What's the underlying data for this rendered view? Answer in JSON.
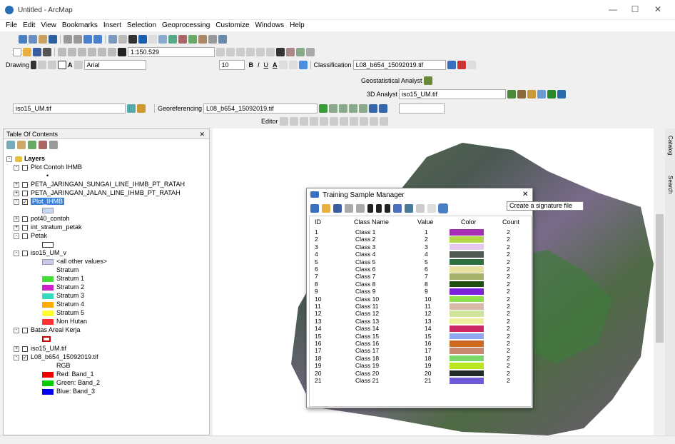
{
  "title": "Untitled - ArcMap",
  "menu": [
    "File",
    "Edit",
    "View",
    "Bookmarks",
    "Insert",
    "Selection",
    "Geoprocessing",
    "Customize",
    "Windows",
    "Help"
  ],
  "scale": "1:150.529",
  "drawing_label": "Drawing",
  "font_name": "Arial",
  "font_size": "10",
  "font_style": [
    "B",
    "I",
    "U"
  ],
  "classification_label": "Classification",
  "classification_layer": "L08_b654_15092019.tif",
  "geostat_label": "Geostatistical Analyst",
  "analyst3d_label": "3D Analyst",
  "analyst3d_layer": "iso15_UM.tif",
  "left_layer_select": "iso15_UM.tif",
  "georef_label": "Georeferencing",
  "georef_layer": "L08_b654_15092019.tif",
  "editor_label": "Editor",
  "toc": {
    "title": "Table Of Contents",
    "close": "✕",
    "rows": [
      {
        "label": "Layers",
        "bold": true
      },
      {
        "label": "Plot Contoh IHMB"
      },
      {
        "label": "•"
      },
      {
        "label": "PETA_JARINGAN_SUNGAI_LINE_IHMB_PT_RATAH"
      },
      {
        "label": "PETA_JARINGAN_JALAN_LINE_IHMB_PT_RATAH"
      },
      {
        "label": "Plot_IHMB",
        "selected": true
      },
      {
        "label": ""
      },
      {
        "label": "pot40_contoh"
      },
      {
        "label": "int_stratum_petak"
      },
      {
        "label": "Petak"
      },
      {
        "label": ""
      },
      {
        "label": "iso15_UM_v"
      },
      {
        "label": "<all other values>"
      },
      {
        "label": "Stratum"
      },
      {
        "label": "Stratum 1",
        "color": "#44dd33"
      },
      {
        "label": "Stratum 2",
        "color": "#cc22cc"
      },
      {
        "label": "Stratum 3",
        "color": "#33ddbb"
      },
      {
        "label": "Stratum 4",
        "color": "#ffaa00"
      },
      {
        "label": "Stratum 5",
        "color": "#ffff33"
      },
      {
        "label": "Non Hutan",
        "color": "#ff3333"
      },
      {
        "label": "Batas Areal Kerja"
      },
      {
        "label": ""
      },
      {
        "label": "iso15_UM.tif"
      },
      {
        "label": "L08_b654_15092019.tif"
      },
      {
        "label": "RGB"
      },
      {
        "label": "Red:   Band_1",
        "color": "#ee0000"
      },
      {
        "label": "Green: Band_2",
        "color": "#00cc00"
      },
      {
        "label": "Blue:  Band_3",
        "color": "#0000ee"
      }
    ]
  },
  "dialog": {
    "title": "Training Sample Manager",
    "close": "✕",
    "headers": [
      "ID",
      "Class Name",
      "Value",
      "Color",
      "Count"
    ],
    "rows": [
      {
        "id": "1",
        "name": "Class 1",
        "value": "1",
        "color": "#a52fb5",
        "count": "2"
      },
      {
        "id": "2",
        "name": "Class 2",
        "value": "2",
        "color": "#b4d84a",
        "count": "2"
      },
      {
        "id": "3",
        "name": "Class 3",
        "value": "3",
        "color": "#e6c9ee",
        "count": "2"
      },
      {
        "id": "4",
        "name": "Class 4",
        "value": "4",
        "color": "#4e5a52",
        "count": "2"
      },
      {
        "id": "5",
        "name": "Class 5",
        "value": "5",
        "color": "#2d6f3f",
        "count": "2"
      },
      {
        "id": "6",
        "name": "Class 6",
        "value": "6",
        "color": "#e8e09e",
        "count": "2"
      },
      {
        "id": "7",
        "name": "Class 7",
        "value": "7",
        "color": "#a6b06a",
        "count": "2"
      },
      {
        "id": "8",
        "name": "Class 8",
        "value": "8",
        "color": "#1f4d12",
        "count": "2"
      },
      {
        "id": "9",
        "name": "Class 9",
        "value": "9",
        "color": "#7b22dd",
        "count": "2"
      },
      {
        "id": "10",
        "name": "Class 10",
        "value": "10",
        "color": "#8ee04c",
        "count": "2"
      },
      {
        "id": "11",
        "name": "Class 11",
        "value": "11",
        "color": "#d8b8a6",
        "count": "2"
      },
      {
        "id": "12",
        "name": "Class 12",
        "value": "12",
        "color": "#cfe39a",
        "count": "2"
      },
      {
        "id": "13",
        "name": "Class 13",
        "value": "13",
        "color": "#ecef9e",
        "count": "2"
      },
      {
        "id": "14",
        "name": "Class 14",
        "value": "14",
        "color": "#cc2a66",
        "count": "2"
      },
      {
        "id": "15",
        "name": "Class 15",
        "value": "15",
        "color": "#8fa8f0",
        "count": "2"
      },
      {
        "id": "16",
        "name": "Class 16",
        "value": "16",
        "color": "#cc6a22",
        "count": "2"
      },
      {
        "id": "17",
        "name": "Class 17",
        "value": "17",
        "color": "#c98770",
        "count": "2"
      },
      {
        "id": "18",
        "name": "Class 18",
        "value": "18",
        "color": "#7ad86a",
        "count": "2"
      },
      {
        "id": "19",
        "name": "Class 19",
        "value": "19",
        "color": "#bbe61e",
        "count": "2"
      },
      {
        "id": "20",
        "name": "Class 20",
        "value": "20",
        "color": "#232a2a",
        "count": "2"
      },
      {
        "id": "21",
        "name": "Class 21",
        "value": "21",
        "color": "#6e5ad6",
        "count": "2"
      }
    ]
  },
  "tooltip": "Create a signature file",
  "right_tabs": [
    "Catalog",
    "Search"
  ]
}
